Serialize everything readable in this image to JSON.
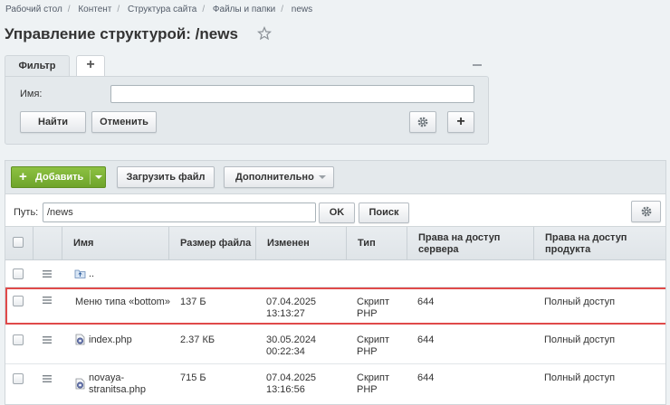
{
  "breadcrumb": [
    "Рабочий стол",
    "Контент",
    "Структура сайта",
    "Файлы и папки",
    "news"
  ],
  "page_title": "Управление структурой: /news",
  "filter": {
    "tab_label": "Фильтр",
    "add_tab": "+",
    "name_label": "Имя:",
    "name_value": "",
    "find_button": "Найти",
    "cancel_button": "Отменить",
    "plus_button": "+"
  },
  "toolbar": {
    "add_button": "Добавить",
    "add_plus": "+",
    "upload_button": "Загрузить файл",
    "more_button": "Дополнительно"
  },
  "pathbar": {
    "label": "Путь:",
    "value": "/news",
    "ok_button": "OK",
    "search_button": "Поиск"
  },
  "table": {
    "columns": [
      "Имя",
      "Размер файла",
      "Изменен",
      "Тип",
      "Права на доступ сервера",
      "Права на доступ продукта"
    ],
    "rows": [
      {
        "name": "..",
        "size": "",
        "modified": "",
        "type": "",
        "server": "",
        "product": "",
        "icon": "folder-up-icon"
      },
      {
        "name": "Меню типа «bottom»",
        "size": "137 Б",
        "modified": "07.04.2025\n13:13:27",
        "type": "Скрипт\nPHP",
        "server": "644",
        "product": "Полный доступ",
        "icon": ""
      },
      {
        "name": "index.php",
        "size": "2.37 КБ",
        "modified": "30.05.2024\n00:22:34",
        "type": "Скрипт\nPHP",
        "server": "644",
        "product": "Полный доступ",
        "icon": "php-file-icon"
      },
      {
        "name": "novaya-\nstranitsa.php",
        "size": "715 Б",
        "modified": "07.04.2025\n13:16:56",
        "type": "Скрипт\nPHP",
        "server": "644",
        "product": "Полный доступ",
        "icon": "php-file-icon"
      }
    ]
  },
  "colors": {
    "accent_green": "#6ea42a",
    "highlight_red": "#e04a4a"
  }
}
